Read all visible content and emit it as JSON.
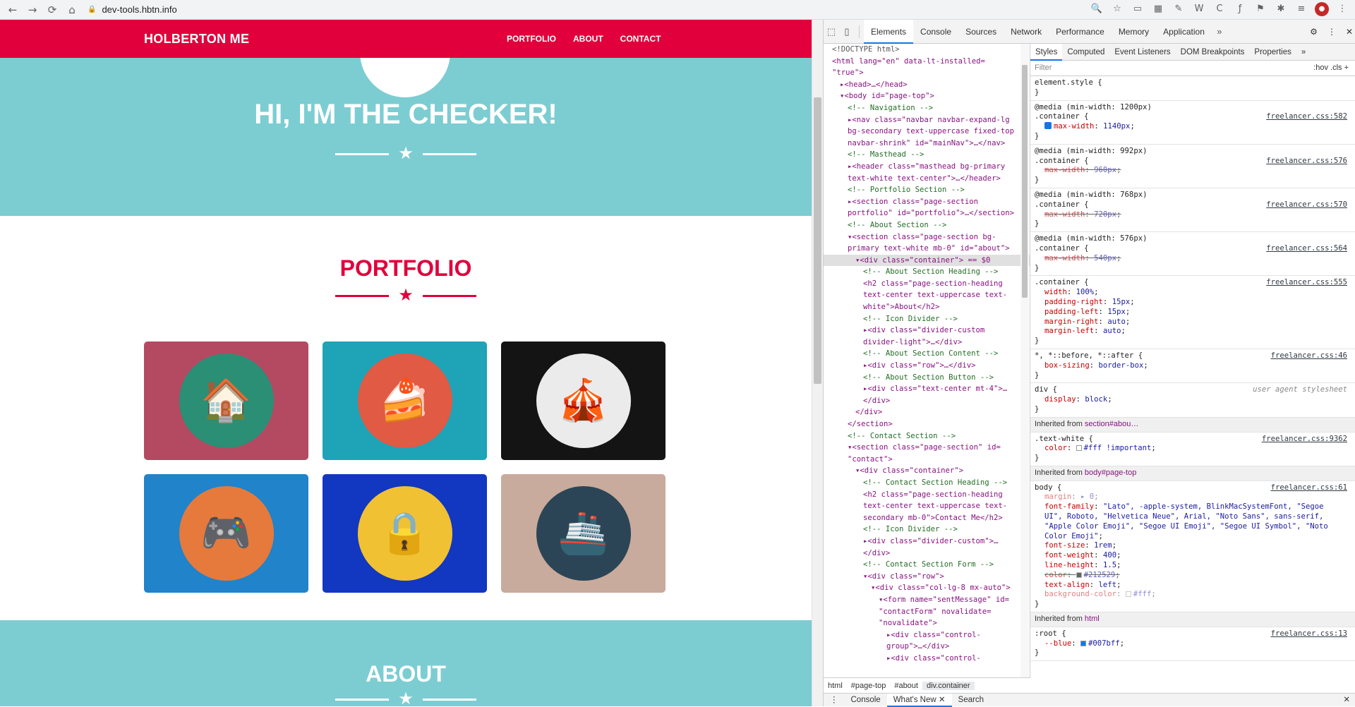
{
  "browser": {
    "url": "dev-tools.hbtn.info",
    "nav_icons": [
      "arrow-left-icon",
      "arrow-right-icon",
      "reload-icon",
      "home-icon"
    ],
    "right_icons": [
      "zoom-icon",
      "star-icon",
      "cast-icon",
      "ext-icon",
      "ext-icon",
      "ext-icon",
      "ext-icon",
      "ext-icon",
      "puzzle-icon",
      "playlist-icon",
      "profile-icon",
      "menu-icon"
    ]
  },
  "site": {
    "brand": "HOLBERTON ME",
    "nav": [
      "PORTFOLIO",
      "ABOUT",
      "CONTACT"
    ],
    "masthead_title": "HI, I'M THE CHECKER!",
    "portfolio_title": "PORTFOLIO",
    "about_title": "ABOUT",
    "colors": {
      "primary": "#e1003c",
      "teal": "#7ccdd2",
      "white": "#ffffff"
    },
    "portfolio_items": [
      {
        "name": "cabin",
        "bg": "#b34a62",
        "circle": "#2a8f75",
        "emoji": "🏠"
      },
      {
        "name": "cake",
        "bg": "#1fa3b6",
        "circle": "#e05a44",
        "emoji": "🍰"
      },
      {
        "name": "circus",
        "bg": "#151414",
        "circle": "#ebebeb",
        "emoji": "🎪"
      },
      {
        "name": "game",
        "bg": "#2183c9",
        "circle": "#e57a3c",
        "emoji": "🎮"
      },
      {
        "name": "safe",
        "bg": "#1237c0",
        "circle": "#f1c134",
        "emoji": "🔒"
      },
      {
        "name": "submarine",
        "bg": "#c8ab9c",
        "circle": "#2c4556",
        "emoji": "🚢"
      }
    ]
  },
  "devtools": {
    "tabs": [
      "Elements",
      "Console",
      "Sources",
      "Network",
      "Performance",
      "Memory",
      "Application"
    ],
    "active_tab": "Elements",
    "elements_tree": [
      {
        "i": 0,
        "h": "<!DOCTYPE html>",
        "k": "mk"
      },
      {
        "i": 0,
        "h": "<html lang=\"en\" data-lt-installed=",
        "k": "t"
      },
      {
        "i": 0,
        "h": "\"true\">",
        "k": "t"
      },
      {
        "i": 1,
        "h": "▸<head>…</head>",
        "k": "t"
      },
      {
        "i": 1,
        "h": "▾<body id=\"page-top\">",
        "k": "t"
      },
      {
        "i": 2,
        "h": "<!-- Navigation -->",
        "k": "cm"
      },
      {
        "i": 2,
        "h": "▸<nav class=\"navbar navbar-expand-lg",
        "k": "t"
      },
      {
        "i": 2,
        "h": "bg-secondary text-uppercase fixed-top",
        "k": "t"
      },
      {
        "i": 2,
        "h": "navbar-shrink\" id=\"mainNav\">…</nav>",
        "k": "t"
      },
      {
        "i": 2,
        "h": "<!-- Masthead -->",
        "k": "cm"
      },
      {
        "i": 2,
        "h": "▸<header class=\"masthead bg-primary",
        "k": "t"
      },
      {
        "i": 2,
        "h": "text-white text-center\">…</header>",
        "k": "t"
      },
      {
        "i": 2,
        "h": "<!-- Portfolio Section -->",
        "k": "cm"
      },
      {
        "i": 2,
        "h": "▸<section class=\"page-section",
        "k": "t"
      },
      {
        "i": 2,
        "h": "portfolio\" id=\"portfolio\">…</section>",
        "k": "t"
      },
      {
        "i": 2,
        "h": "<!-- About Section -->",
        "k": "cm"
      },
      {
        "i": 2,
        "h": "▾<section class=\"page-section bg-",
        "k": "t"
      },
      {
        "i": 2,
        "h": "primary text-white mb-0\" id=\"about\">",
        "k": "t"
      },
      {
        "i": 3,
        "h": "▾<div class=\"container\"> == $0",
        "k": "sel"
      },
      {
        "i": 4,
        "h": "<!-- About Section Heading -->",
        "k": "cm"
      },
      {
        "i": 4,
        "h": "<h2 class=\"page-section-heading",
        "k": "t"
      },
      {
        "i": 4,
        "h": "text-center text-uppercase text-",
        "k": "t"
      },
      {
        "i": 4,
        "h": "white\">About</h2>",
        "k": "t"
      },
      {
        "i": 4,
        "h": "<!-- Icon Divider -->",
        "k": "cm"
      },
      {
        "i": 4,
        "h": "▸<div class=\"divider-custom",
        "k": "t"
      },
      {
        "i": 4,
        "h": "divider-light\">…</div>",
        "k": "t"
      },
      {
        "i": 4,
        "h": "<!-- About Section Content -->",
        "k": "cm"
      },
      {
        "i": 4,
        "h": "▸<div class=\"row\">…</div>",
        "k": "t"
      },
      {
        "i": 4,
        "h": "<!-- About Section Button -->",
        "k": "cm"
      },
      {
        "i": 4,
        "h": "▸<div class=\"text-center mt-4\">…",
        "k": "t"
      },
      {
        "i": 4,
        "h": "</div>",
        "k": "t"
      },
      {
        "i": 3,
        "h": "</div>",
        "k": "t"
      },
      {
        "i": 2,
        "h": "</section>",
        "k": "t"
      },
      {
        "i": 2,
        "h": "<!-- Contact Section -->",
        "k": "cm"
      },
      {
        "i": 2,
        "h": "▾<section class=\"page-section\" id=",
        "k": "t"
      },
      {
        "i": 2,
        "h": "\"contact\">",
        "k": "t"
      },
      {
        "i": 3,
        "h": "▾<div class=\"container\">",
        "k": "t"
      },
      {
        "i": 4,
        "h": "<!-- Contact Section Heading -->",
        "k": "cm"
      },
      {
        "i": 4,
        "h": "<h2 class=\"page-section-heading",
        "k": "t"
      },
      {
        "i": 4,
        "h": "text-center text-uppercase text-",
        "k": "t"
      },
      {
        "i": 4,
        "h": "secondary mb-0\">Contact Me</h2>",
        "k": "t"
      },
      {
        "i": 4,
        "h": "<!-- Icon Divider -->",
        "k": "cm"
      },
      {
        "i": 4,
        "h": "▸<div class=\"divider-custom\">…",
        "k": "t"
      },
      {
        "i": 4,
        "h": "</div>",
        "k": "t"
      },
      {
        "i": 4,
        "h": "<!-- Contact Section Form -->",
        "k": "cm"
      },
      {
        "i": 4,
        "h": "▾<div class=\"row\">",
        "k": "t"
      },
      {
        "i": 5,
        "h": "▾<div class=\"col-lg-8 mx-auto\">",
        "k": "t"
      },
      {
        "i": 6,
        "h": "▾<form name=\"sentMessage\" id=",
        "k": "t"
      },
      {
        "i": 6,
        "h": "\"contactForm\" novalidate=",
        "k": "t"
      },
      {
        "i": 6,
        "h": "\"novalidate\">",
        "k": "t"
      },
      {
        "i": 7,
        "h": "▸<div class=\"control-",
        "k": "t"
      },
      {
        "i": 7,
        "h": "group\">…</div>",
        "k": "t"
      },
      {
        "i": 7,
        "h": "▸<div class=\"control-",
        "k": "t"
      }
    ],
    "breadcrumbs": [
      "html",
      "#page-top",
      "#about",
      "div.container"
    ],
    "styles_tabs": [
      "Styles",
      "Computed",
      "Event Listeners",
      "DOM Breakpoints",
      "Properties"
    ],
    "filter_placeholder": "Filter",
    "filter_right": ":hov  .cls  +",
    "rules": [
      {
        "media": "",
        "sel": "element.style {",
        "src": "",
        "props": []
      },
      {
        "media": "@media (min-width: 1200px)",
        "sel": ".container {",
        "src": "freelancer.css:582",
        "props": [
          {
            "n": "max-width",
            "v": "1140px",
            "s": false,
            "c": true
          }
        ]
      },
      {
        "media": "@media (min-width: 992px)",
        "sel": ".container {",
        "src": "freelancer.css:576",
        "props": [
          {
            "n": "max-width",
            "v": "960px",
            "s": true
          }
        ]
      },
      {
        "media": "@media (min-width: 768px)",
        "sel": ".container {",
        "src": "freelancer.css:570",
        "props": [
          {
            "n": "max-width",
            "v": "720px",
            "s": true
          }
        ]
      },
      {
        "media": "@media (min-width: 576px)",
        "sel": ".container {",
        "src": "freelancer.css:564",
        "props": [
          {
            "n": "max-width",
            "v": "540px",
            "s": true
          }
        ]
      },
      {
        "media": "",
        "sel": ".container {",
        "src": "freelancer.css:555",
        "props": [
          {
            "n": "width",
            "v": "100%"
          },
          {
            "n": "padding-right",
            "v": "15px"
          },
          {
            "n": "padding-left",
            "v": "15px"
          },
          {
            "n": "margin-right",
            "v": "auto"
          },
          {
            "n": "margin-left",
            "v": "auto"
          }
        ]
      },
      {
        "media": "",
        "sel": "*, *::before, *::after {",
        "src": "freelancer.css:46",
        "props": [
          {
            "n": "box-sizing",
            "v": "border-box"
          }
        ]
      },
      {
        "media": "",
        "sel": "div {",
        "src": "user agent stylesheet",
        "ua": true,
        "props": [
          {
            "n": "display",
            "v": "block"
          }
        ]
      }
    ],
    "inherited_1": {
      "label": "Inherited from",
      "target": "section#abou…"
    },
    "rule_text_white": {
      "sel": ".text-white {",
      "src": "freelancer.css:9362",
      "props": [
        {
          "n": "color",
          "v": "#fff !important"
        }
      ]
    },
    "inherited_2": {
      "label": "Inherited from",
      "target": "body#page-top"
    },
    "rule_body": {
      "sel": "body {",
      "src": "freelancer.css:61",
      "props": [
        {
          "n": "margin",
          "v": "▸ 0",
          "muted": true
        },
        {
          "n": "font-family",
          "v": "\"Lato\", -apple-system, BlinkMacSystemFont, \"Segoe UI\", Roboto, \"Helvetica Neue\", Arial, \"Noto Sans\", sans-serif, \"Apple Color Emoji\", \"Segoe UI Emoji\", \"Segoe UI Symbol\", \"Noto Color Emoji\""
        },
        {
          "n": "font-size",
          "v": "1rem"
        },
        {
          "n": "font-weight",
          "v": "400"
        },
        {
          "n": "line-height",
          "v": "1.5"
        },
        {
          "n": "color",
          "v": "#212529",
          "s": true
        },
        {
          "n": "text-align",
          "v": "left"
        },
        {
          "n": "background-color",
          "v": "#fff",
          "muted": true
        }
      ]
    },
    "inherited_3": {
      "label": "Inherited from",
      "target": "html"
    },
    "rule_root": {
      "sel": ":root {",
      "src": "freelancer.css:13",
      "props": [
        {
          "n": "--blue",
          "v": "#007bff"
        }
      ]
    },
    "drawer_tabs": [
      "Console",
      "What's New",
      "Search"
    ]
  }
}
